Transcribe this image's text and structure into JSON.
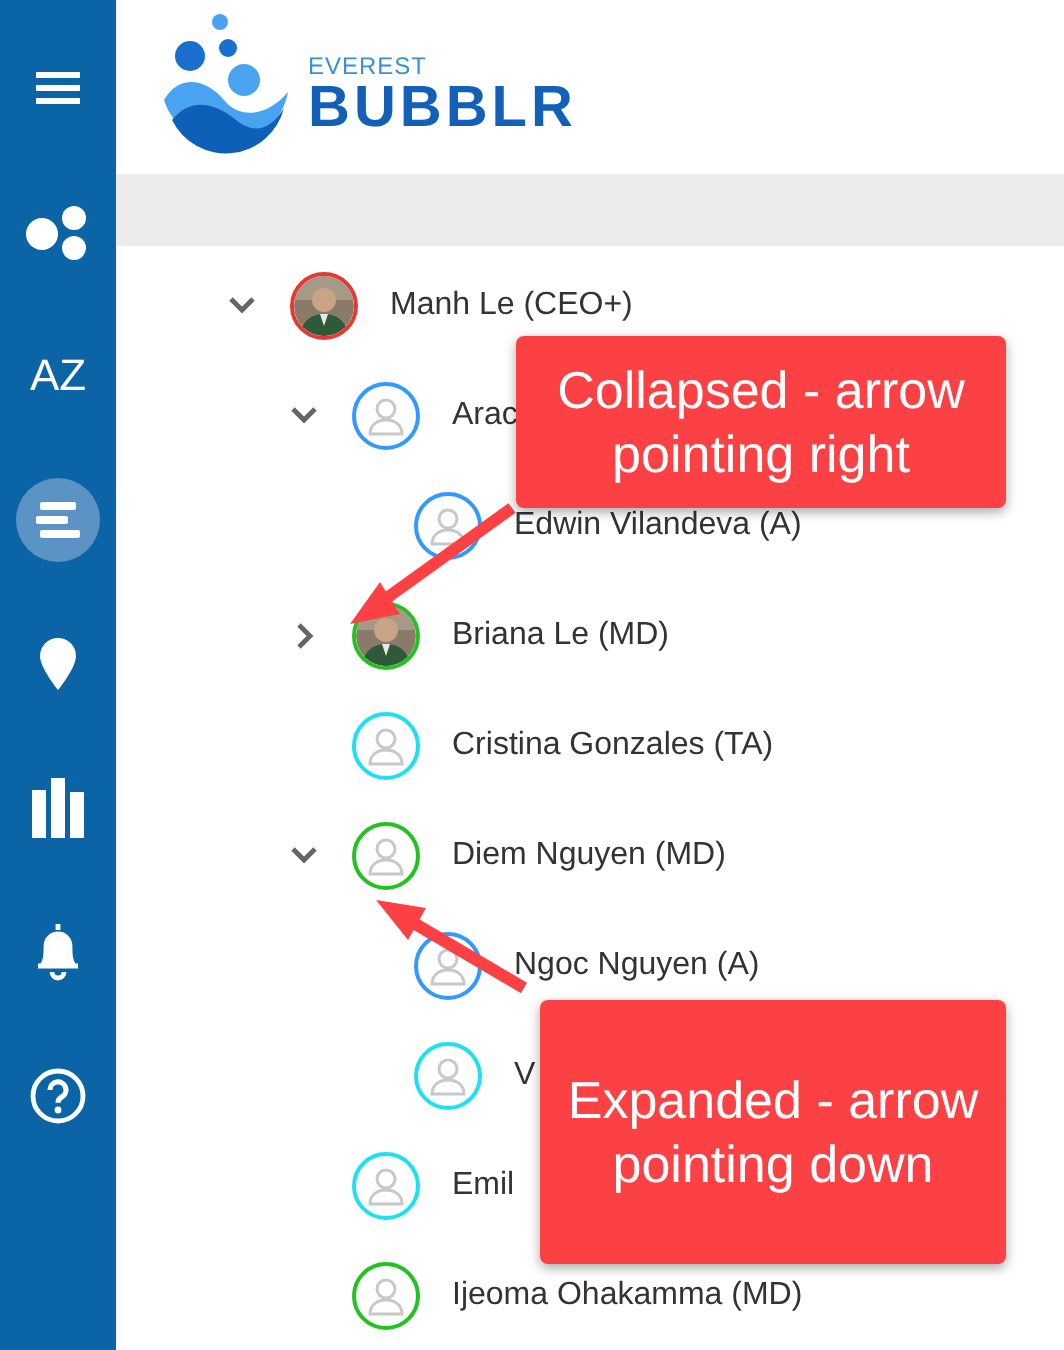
{
  "sidebar": {
    "items": [
      {
        "kind": "menu",
        "selected": false
      },
      {
        "kind": "bubbles",
        "selected": false
      },
      {
        "kind": "text",
        "label": "AZ",
        "selected": false
      },
      {
        "kind": "list",
        "selected": true
      },
      {
        "kind": "pin",
        "selected": false
      },
      {
        "kind": "chart",
        "selected": false
      },
      {
        "kind": "bell",
        "selected": false
      },
      {
        "kind": "help",
        "selected": false
      }
    ]
  },
  "logo": {
    "tagline": "EVEREST",
    "name": "BUBBLR"
  },
  "tree": [
    {
      "name": "Manh Le (CEO+)",
      "color": "#e53935",
      "expanded": true,
      "children": [
        {
          "name": "Arac",
          "kind": "default",
          "color": "#3399ff",
          "expanded": true,
          "children": [
            {
              "name": "Edwin Vilandeva (A)",
              "kind": "default",
              "color": "#3399ff"
            }
          ]
        },
        {
          "name": "Briana Le (MD)",
          "color": "#22c222",
          "expanded": false
        },
        {
          "name": "Cristina Gonzales (TA)",
          "kind": "default",
          "color": "#1ee0f0"
        },
        {
          "name": "Diem Nguyen (MD)",
          "kind": "default",
          "color": "#22c222",
          "expanded": true,
          "children": [
            {
              "name": "Ngoc Nguyen (A)",
              "kind": "default",
              "color": "#3399ff"
            },
            {
              "name": "V",
              "kind": "default",
              "color": "#1ee0f0"
            }
          ]
        },
        {
          "name": "Emil",
          "kind": "default",
          "color": "#1ee0f0"
        },
        {
          "name": "Ijeoma Ohakamma (MD)",
          "kind": "default",
          "color": "#22c222"
        }
      ]
    }
  ],
  "callouts": [
    {
      "text": "Collapsed - arrow pointing right"
    },
    {
      "text": "Expanded - arrow pointing down"
    }
  ]
}
